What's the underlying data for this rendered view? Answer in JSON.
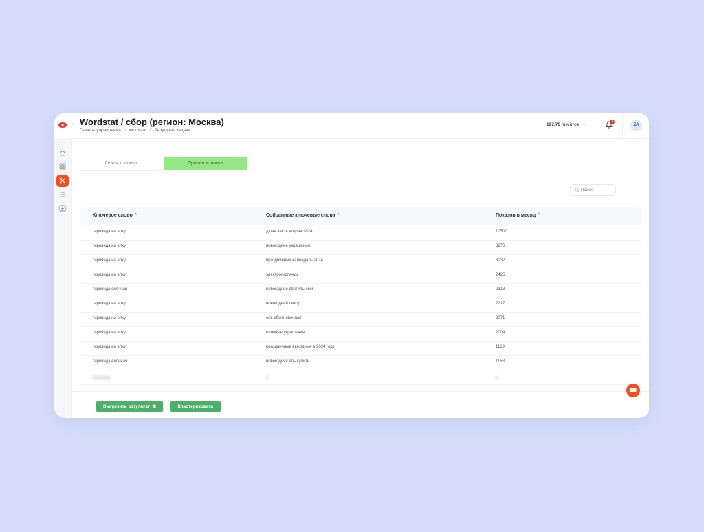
{
  "header": {
    "title": "Wordstat / сбор (регион: Москва)",
    "breadcrumbs": [
      "Панель управления",
      "Wordstat",
      "Результат задачи"
    ],
    "breadcrumb_separator": "//",
    "limits_value": "197.76",
    "limits_label": "лимитов",
    "limits_add": "+",
    "notifications_count": "2",
    "avatar_initials": "ZA"
  },
  "sidebar": {
    "items": [
      {
        "icon": "home-icon"
      },
      {
        "icon": "grid-icon"
      },
      {
        "icon": "tools-icon",
        "active": true
      },
      {
        "icon": "list-icon"
      },
      {
        "icon": "download-icon"
      }
    ]
  },
  "tabs": [
    {
      "label": "Левая колонка",
      "active": false
    },
    {
      "label": "Правая колонка",
      "active": true
    }
  ],
  "search": {
    "placeholder": "Поиск",
    "value": ""
  },
  "table": {
    "columns": [
      "Ключевое слово",
      "Собранные ключевые слова",
      "Показов в месяц"
    ],
    "sort_glyph": "^",
    "rows": [
      [
        "гирлянда на елку",
        "дюна часть вторая 2024",
        "10500"
      ],
      [
        "гирлянда на елку",
        "новогодние украшения",
        "3276"
      ],
      [
        "гирлянда на елку",
        "праздничный календарь 2024",
        "3032"
      ],
      [
        "гирлянда на елку",
        "электрогирлянда",
        "2425"
      ],
      [
        "гирлянда елочная",
        "новогодние светильники",
        "2313"
      ],
      [
        "гирлянда на елку",
        "новогодний декор",
        "2217"
      ],
      [
        "гирлянда на елку",
        "ель обыкновенная",
        "2071"
      ],
      [
        "гирлянда на елку",
        "елочные украшения",
        "2004"
      ],
      [
        "гирлянда на елку",
        "праздничные выходные в 2024 году",
        "1169"
      ],
      [
        "гирлянда елочная",
        "новогодняя ель купить",
        "1158"
      ]
    ]
  },
  "footer": {
    "export_label": "Выгрузить результат",
    "cluster_label": "Кластеризовать"
  },
  "colors": {
    "accent": "#f04e23",
    "tab_active": "#96e887",
    "button_green": "#4caf6a",
    "background": "#d5ddfb"
  }
}
